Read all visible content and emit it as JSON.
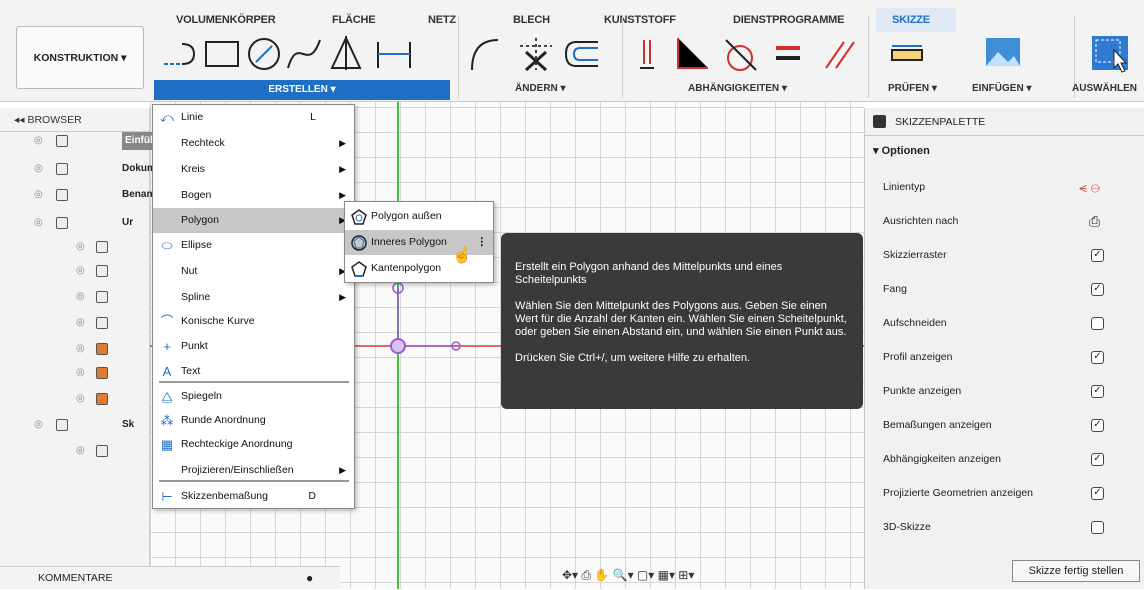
{
  "toolbar": {
    "tabs": [
      "VOLUMENKÖRPER",
      "FLÄCHE",
      "NETZ",
      "BLECH",
      "KUNSTSTOFF",
      "DIENSTPROGRAMME",
      "SKIZZE"
    ],
    "workspace": "KONSTRUKTION ▾",
    "groups": {
      "erstellen": "ERSTELLEN ▾",
      "aendern": "ÄNDERN ▾",
      "abhaengigkeiten": "ABHÄNGIGKEITEN ▾",
      "pruefen": "PRÜFEN ▾",
      "einfuegen": "EINFÜGEN ▾",
      "auswaehlen": "AUSWÄHLEN"
    }
  },
  "browser": {
    "title": "◂◂  BROWSER",
    "rows": [
      {
        "label": "Einfüh"
      },
      {
        "label": "Dokume"
      },
      {
        "label": "Benann"
      },
      {
        "label": "Ur"
      },
      {
        "label": ""
      },
      {
        "label": ""
      },
      {
        "label": ""
      },
      {
        "label": ""
      },
      {
        "label": ""
      },
      {
        "label": ""
      },
      {
        "label": ""
      },
      {
        "label": "Sk"
      },
      {
        "label": ""
      }
    ]
  },
  "menu": {
    "items": [
      {
        "label": "Linie",
        "shortcut": "L",
        "arrow": ""
      },
      {
        "label": "Rechteck",
        "shortcut": "",
        "arrow": "▶"
      },
      {
        "label": "Kreis",
        "shortcut": "",
        "arrow": "▶"
      },
      {
        "label": "Bogen",
        "shortcut": "",
        "arrow": "▶"
      },
      {
        "label": "Polygon",
        "shortcut": "",
        "arrow": "▶"
      },
      {
        "label": "Ellipse",
        "shortcut": "",
        "arrow": ""
      },
      {
        "label": "Nut",
        "shortcut": "",
        "arrow": "▶"
      },
      {
        "label": "Spline",
        "shortcut": "",
        "arrow": "▶"
      },
      {
        "label": "Konische Kurve",
        "shortcut": "",
        "arrow": ""
      },
      {
        "label": "Punkt",
        "shortcut": "",
        "arrow": ""
      },
      {
        "label": "Text",
        "shortcut": "",
        "arrow": ""
      },
      {
        "label": "Spiegeln",
        "shortcut": "",
        "arrow": ""
      },
      {
        "label": "Runde Anordnung",
        "shortcut": "",
        "arrow": ""
      },
      {
        "label": "Rechteckige Anordnung",
        "shortcut": "",
        "arrow": ""
      },
      {
        "label": "Projizieren/Einschließen",
        "shortcut": "",
        "arrow": "▶"
      },
      {
        "label": "Skizzenbemaßung",
        "shortcut": "D",
        "arrow": ""
      }
    ],
    "submenu": [
      "Polygon außen",
      "Inneres Polygon",
      "Kantenpolygon"
    ]
  },
  "tooltip": {
    "title": "Erstellt ein Polygon anhand des Mittelpunkts und eines Scheitelpunkts",
    "body": "Wählen Sie den Mittelpunkt des Polygons aus. Geben Sie einen Wert für die Anzahl der Kanten ein. Wählen Sie einen Scheitelpunkt, oder geben Sie einen Abstand ein, und wählen Sie einen Punkt aus.",
    "hint": "Drücken Sie Ctrl+/, um weitere Hilfe zu erhalten."
  },
  "palette": {
    "title": "SKIZZENPALETTE",
    "section": "▾ Optionen",
    "rows": [
      {
        "label": "Linientyp",
        "checked": null
      },
      {
        "label": "Ausrichten nach",
        "checked": null
      },
      {
        "label": "Skizzierraster",
        "checked": true
      },
      {
        "label": "Fang",
        "checked": true
      },
      {
        "label": "Aufschneiden",
        "checked": false
      },
      {
        "label": "Profil anzeigen",
        "checked": true
      },
      {
        "label": "Punkte anzeigen",
        "checked": true
      },
      {
        "label": "Bemaßungen anzeigen",
        "checked": true
      },
      {
        "label": "Abhängigkeiten anzeigen",
        "checked": true
      },
      {
        "label": "Projizierte Geometrien anzeigen",
        "checked": true
      },
      {
        "label": "3D-Skizze",
        "checked": false
      }
    ],
    "finish": "Skizze fertig stellen"
  },
  "bottom": {
    "kommentare": "KOMMENTARE"
  },
  "colors": {
    "accent": "#1f6fc5",
    "x_axis": "#d63a3a",
    "y_axis": "#3cc43c",
    "tooltip_bg": "#3a3a3a",
    "polygon": "#9b59d0"
  }
}
